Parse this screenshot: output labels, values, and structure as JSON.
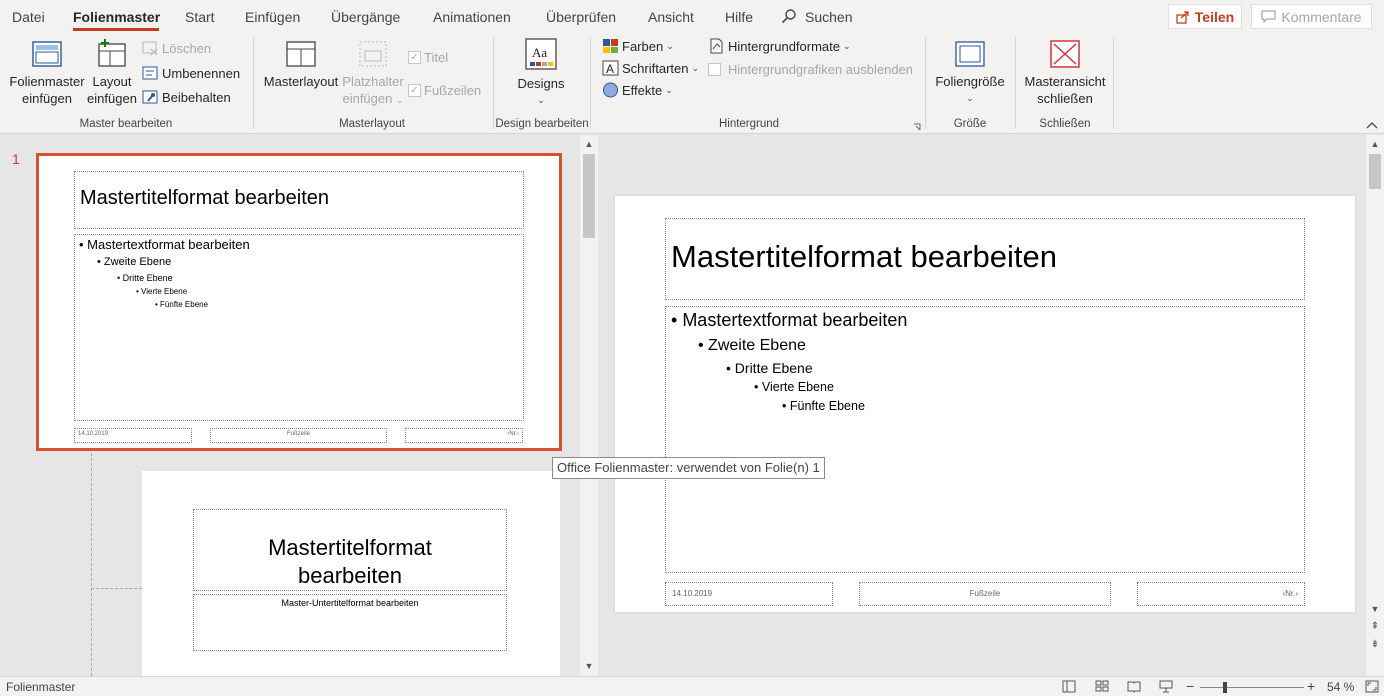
{
  "menu": {
    "tabs": [
      "Datei",
      "Folienmaster",
      "Start",
      "Einfügen",
      "Übergänge",
      "Animationen",
      "Überprüfen",
      "Ansicht",
      "Hilfe"
    ],
    "active_tab": "Folienmaster",
    "search": "Suchen",
    "share": "Teilen",
    "comments": "Kommentare"
  },
  "ribbon": {
    "master_edit": {
      "insert_master": [
        "Folienmaster",
        "einfügen"
      ],
      "insert_layout": [
        "Layout",
        "einfügen"
      ],
      "delete": "Löschen",
      "rename": "Umbenennen",
      "preserve": "Beibehalten",
      "group_label": "Master bearbeiten"
    },
    "master_layout": {
      "master_layout_btn": "Masterlayout",
      "insert_placeholder": [
        "Platzhalter",
        "einfügen"
      ],
      "title_check": "Titel",
      "footer_check": "Fußzeilen",
      "group_label": "Masterlayout"
    },
    "design": {
      "designs": "Designs",
      "group_label": "Design bearbeiten"
    },
    "background": {
      "colors": "Farben",
      "fonts": "Schriftarten",
      "effects": "Effekte",
      "bg_styles": "Hintergrundformate",
      "hide_bg": "Hintergrundgrafiken ausblenden",
      "group_label": "Hintergrund"
    },
    "size": {
      "slide_size": "Foliengröße",
      "group_label": "Größe"
    },
    "close": {
      "close_master": [
        "Masteransicht",
        "schließen"
      ],
      "group_label": "Schließen"
    }
  },
  "thumbnails": {
    "slide_number": "1",
    "master": {
      "title": "Mastertitelformat bearbeiten",
      "levels": [
        "Mastertextformat bearbeiten",
        "Zweite Ebene",
        "Dritte Ebene",
        "Vierte Ebene",
        "Fünfte Ebene"
      ],
      "date": "14.10.2019",
      "footer": "Fußzeile",
      "number": "‹Nr.›"
    },
    "layout1": {
      "title_line1": "Mastertitelformat",
      "title_line2": "bearbeiten",
      "subtitle": "Master-Untertitelformat bearbeiten"
    },
    "tooltip": "Office Folienmaster: verwendet von Folie(n) 1"
  },
  "slide": {
    "title": "Mastertitelformat bearbeiten",
    "levels": [
      "Mastertextformat bearbeiten",
      "Zweite Ebene",
      "Dritte Ebene",
      "Vierte Ebene",
      "Fünfte Ebene"
    ],
    "date": "14.10.2019",
    "footer": "Fußzeile",
    "number": "‹Nr.›"
  },
  "status": {
    "view_name": "Folienmaster",
    "zoom": "54 %"
  },
  "colors": {
    "accent": "#c43e1c",
    "selection": "#d35230",
    "close_icon": "#d13438"
  }
}
